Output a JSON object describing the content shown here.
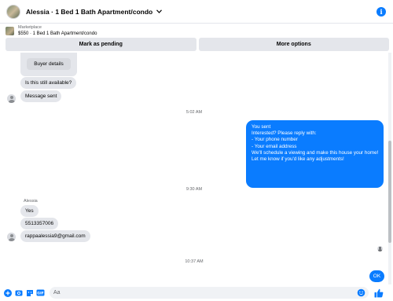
{
  "header": {
    "title": "Alessia · 1 Bed 1 Bath Apartment/condo",
    "accent": "#0a7cff"
  },
  "marketplace": {
    "label": "Marketplace",
    "listing": "$550 · 1 Bed 1 Bath Apartment/condo",
    "actions": [
      "Mark as pending",
      "More options"
    ]
  },
  "conversation": {
    "buyer_details_label": "Buyer details",
    "messages_in_1": [
      "Is this still available?",
      "Message sent"
    ],
    "timestamp_1": "5:02 AM",
    "outgoing": [
      "You sent",
      "Interested? Please reply with:",
      "- Your phone number",
      "- Your email address",
      "",
      "We'll schedule a viewing and make this house your home!",
      "",
      "Let me know if you'd like any adjustments!"
    ],
    "timestamp_2": "9:30 AM",
    "sender_name": "Alessia",
    "messages_in_2": [
      "Yes",
      "5513357006",
      "rappaalessia9@gmail.com"
    ],
    "timestamp_3": "10:37 AM",
    "last_outgoing": "OK"
  },
  "composer": {
    "placeholder": "Aa",
    "icons": [
      "plus-icon",
      "camera-icon",
      "sticker-icon",
      "gif-icon",
      "emoji-icon",
      "thumbs-up-icon"
    ]
  }
}
